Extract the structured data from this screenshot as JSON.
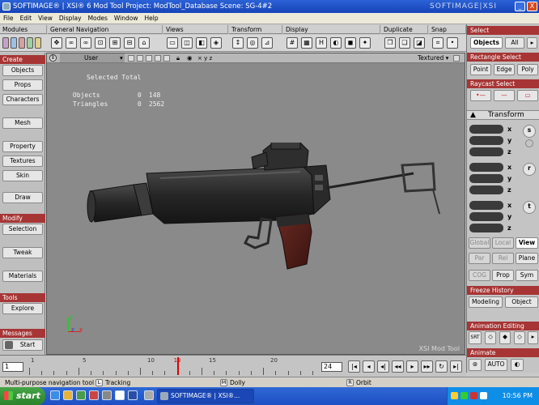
{
  "window": {
    "title": "SOFTIMAGE® | XSI® 6 Mod Tool Project: ModTool_Database   Scene: SG-4#2",
    "brand": "SOFTIMAGE|XSI",
    "minimize": "_",
    "close": "X"
  },
  "menu": [
    "File",
    "Edit",
    "View",
    "Display",
    "Modes",
    "Window",
    "Help"
  ],
  "toolbar_groups": [
    "Modules",
    "General Navigation",
    "Views",
    "Transform",
    "Display",
    "Duplicate",
    "Snap"
  ],
  "left_panel": {
    "sections": [
      {
        "header": "Create",
        "buttons": [
          "Objects",
          "Props",
          "Characters",
          "Mesh",
          "Property",
          "Textures",
          "Skin",
          "Draw"
        ]
      },
      {
        "header": "Modify",
        "buttons": [
          "Selection",
          "Tweak",
          "Materials"
        ]
      },
      {
        "header": "Tools",
        "buttons": [
          "Explore"
        ]
      },
      {
        "header": "Messages",
        "buttons": [
          "Start"
        ]
      }
    ]
  },
  "viewport": {
    "camera": "User",
    "shading": "Textured",
    "corner": "B",
    "stats_header": "Selected Total",
    "stats": [
      {
        "label": "Objects",
        "selected": "0",
        "total": "148"
      },
      {
        "label": "Triangles",
        "selected": "0",
        "total": "2562"
      }
    ],
    "watermark": "XSI Mod Tool",
    "axes": {
      "y": "y",
      "z": "z",
      "x": "x"
    }
  },
  "right_panel": {
    "select_header": "Select",
    "objects_button": "Objects",
    "all_button": "All",
    "rect_header": "Rectangle Select",
    "rect_buttons": [
      "Point",
      "Edge",
      "Poly"
    ],
    "raycast_header": "Raycast Select",
    "transform_header": "Transform",
    "transform_groups": [
      {
        "key": "s",
        "axes": [
          "x",
          "y",
          "z"
        ]
      },
      {
        "key": "r",
        "axes": [
          "x",
          "y",
          "z"
        ]
      },
      {
        "key": "t",
        "axes": [
          "x",
          "y",
          "z"
        ]
      }
    ],
    "space_buttons": [
      "Global",
      "Local",
      "View"
    ],
    "ref_buttons": [
      "Par",
      "Rel",
      "Plane"
    ],
    "cog_buttons": [
      "COG",
      "Prop",
      "Sym"
    ],
    "freeze_header": "Freeze History",
    "freeze_buttons": [
      "Modeling",
      "Object"
    ],
    "anim_edit_header": "Animation Editing",
    "srt_label": "SRT",
    "animate_header": "Animate",
    "auto_label": "AUTO"
  },
  "timeline": {
    "start_frame": "1",
    "end_frame": "24",
    "current_frame": "13",
    "current_value": 13,
    "range_start": 1,
    "range_end": 24,
    "tick_labels": [
      "1",
      "5",
      "10",
      "15",
      "20"
    ]
  },
  "status": {
    "hint": "Multi-purpose navigation tool",
    "left_mouse": "L",
    "left_action": "Tracking",
    "middle_mouse": "M",
    "middle_action": "Dolly",
    "right_mouse": "R",
    "right_action": "Orbit"
  },
  "taskbar": {
    "start": "start",
    "items": [
      "SOFTIMAGE® | XSI®..."
    ],
    "clock": "10:56 PM"
  }
}
